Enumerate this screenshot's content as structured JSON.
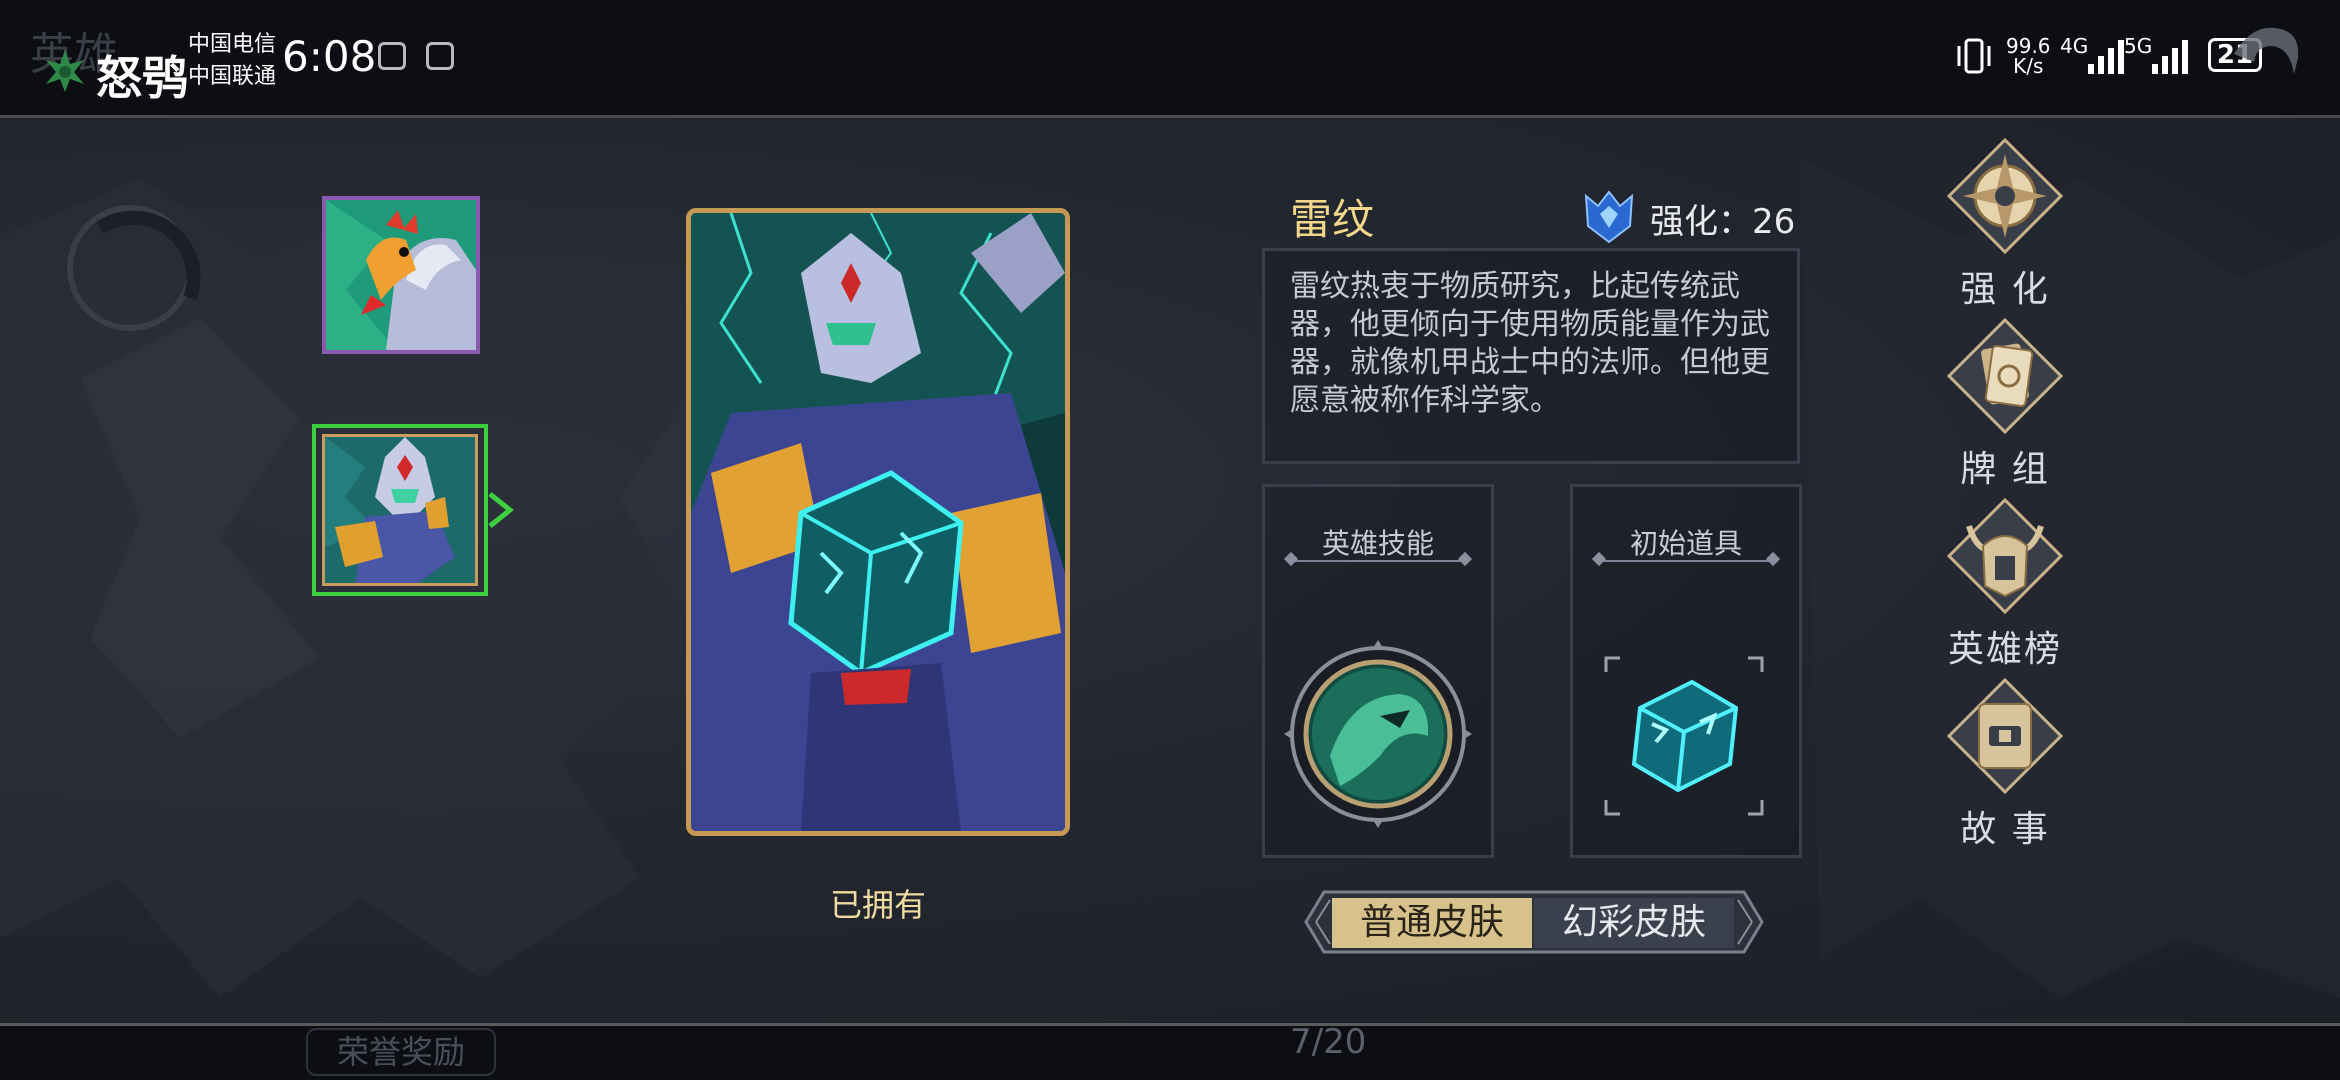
{
  "status_bar": {
    "background_title": "英雄",
    "app_name": "怒鸮",
    "carrier_1": "中国电信",
    "carrier_2": "中国联通",
    "time": "6:08",
    "net_speed_value": "99.6",
    "net_speed_unit": "K/s",
    "signal_1": "4G",
    "signal_2": "5G",
    "battery": "21"
  },
  "hero": {
    "name": "雷纹",
    "enhance_label": "强化：26",
    "description": "雷纹热衷于物质研究，比起传统武器，他更倾向于使用物质能量作为武器，就像机甲战士中的法师。但他更愿意被称作科学家。",
    "owned_status": "已拥有"
  },
  "panels": {
    "skill_label": "英雄技能",
    "item_label": "初始道具"
  },
  "skins": {
    "normal": "普通皮肤",
    "rainbow": "幻彩皮肤",
    "selected": "普通皮肤"
  },
  "menu": {
    "enhance": "强 化",
    "deck": "牌 组",
    "ranking": "英雄榜",
    "story": "故 事"
  },
  "footer": {
    "page": "7/20",
    "honor": "荣誉奖励"
  },
  "colors": {
    "accent_gold": "#c69a55",
    "selected_green": "#3ecf3e",
    "skin_active": "#d8c28c"
  }
}
